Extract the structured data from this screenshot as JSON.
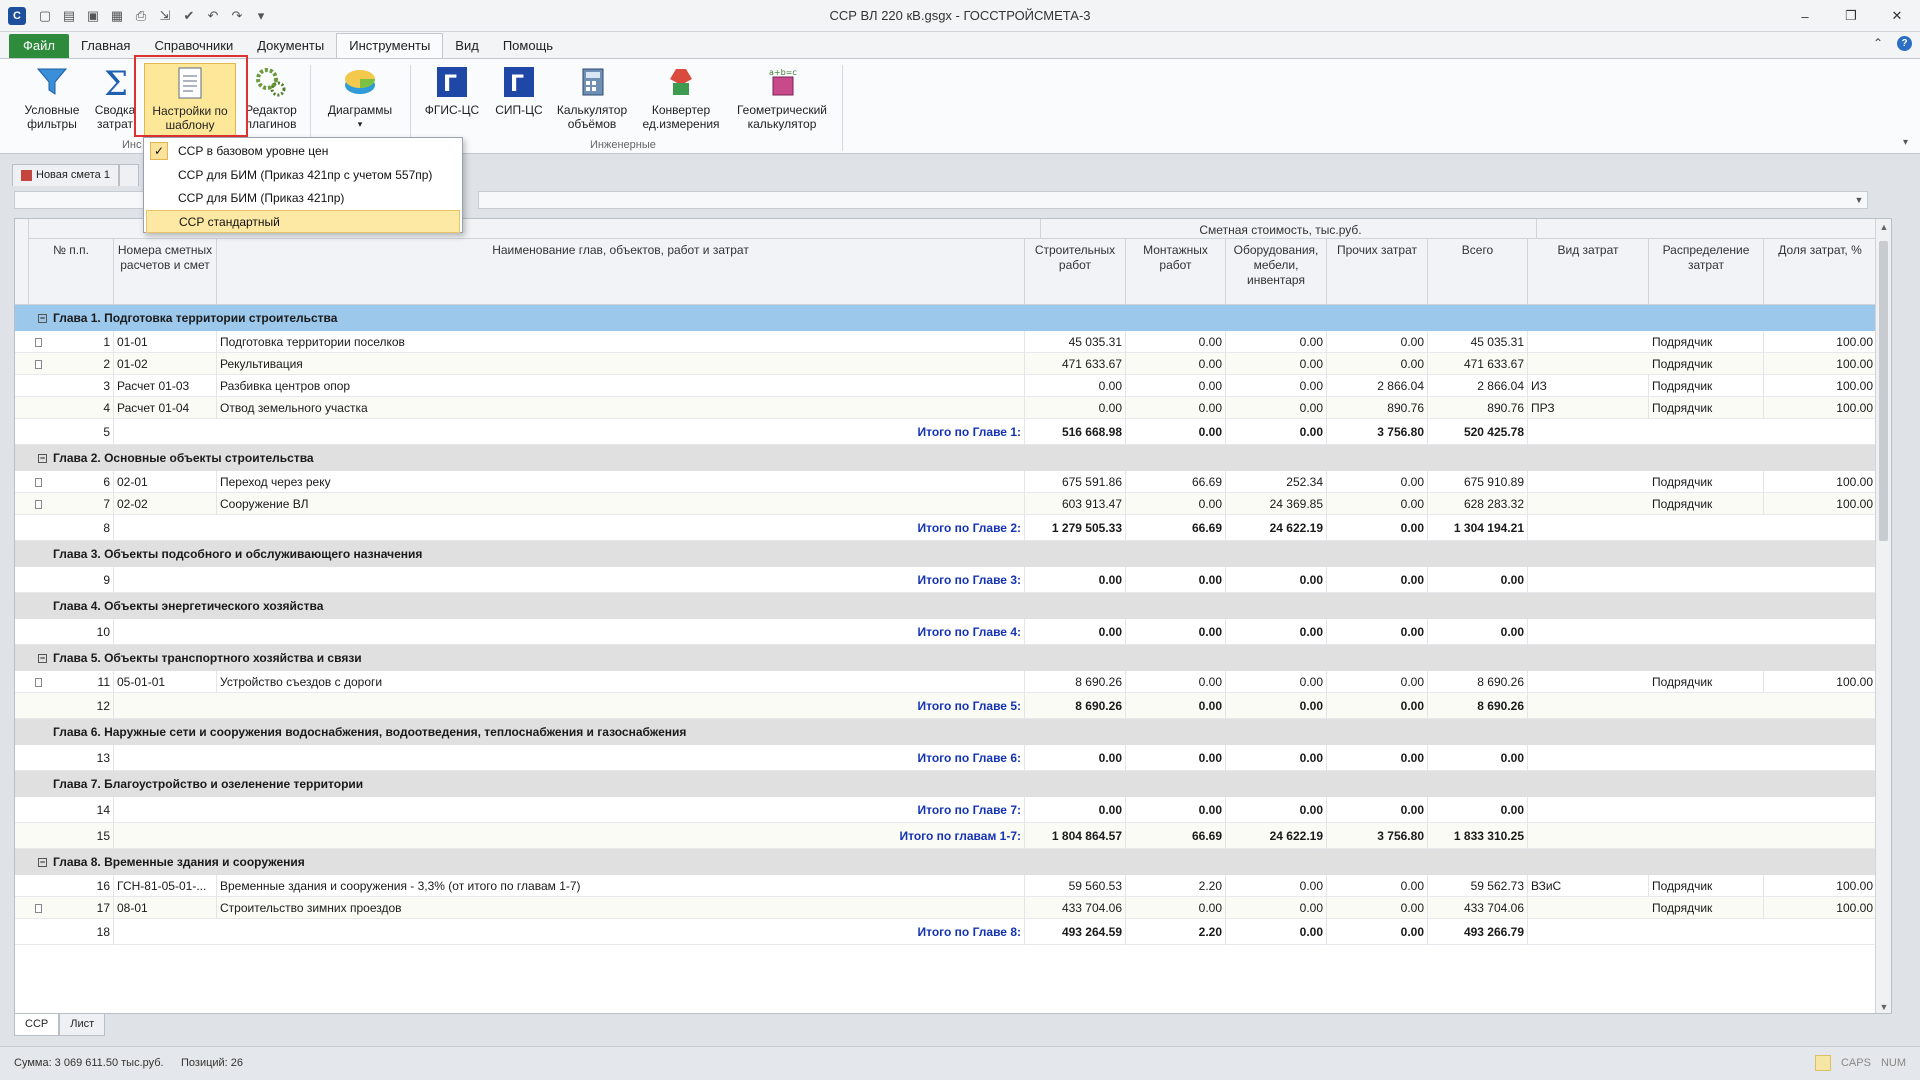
{
  "window": {
    "title": "ССР ВЛ 220 кВ.gsgx - ГОССТРОЙСМЕТА-3",
    "app_icon": "С"
  },
  "ribbon_tabs": [
    "Файл",
    "Главная",
    "Справочники",
    "Документы",
    "Инструменты",
    "Вид",
    "Помощь"
  ],
  "ribbon": {
    "buttons": [
      {
        "label": "Условные фильтры",
        "icon": "funnel-icon"
      },
      {
        "label": "Сводка затрат",
        "icon": "sigma-icon"
      },
      {
        "label": "Настройки по шаблону",
        "icon": "template-doc-icon"
      },
      {
        "label": "Редактор плагинов",
        "icon": "gears-icon"
      },
      {
        "label": "Диаграммы",
        "icon": "pie-chart-icon"
      },
      {
        "label": "ФГИС-ЦС",
        "icon": "fgis-icon"
      },
      {
        "label": "СИП-ЦС",
        "icon": "sip-icon"
      },
      {
        "label": "Калькулятор объёмов",
        "icon": "volume-calc-icon"
      },
      {
        "label": "Конвертер ед.измерения",
        "icon": "unit-converter-icon"
      },
      {
        "label": "Геометрический калькулятор",
        "icon": "geometry-calc-icon"
      }
    ],
    "group_label_left": "Инс",
    "group_label_right": "Инженерные"
  },
  "template_menu": {
    "items": [
      {
        "label": "ССР в базовом уровне цен",
        "checked": true,
        "highlighted": false
      },
      {
        "label": "ССР для БИМ (Приказ 421пр с учетом 557пр)",
        "checked": false,
        "highlighted": false
      },
      {
        "label": "ССР для БИМ (Приказ 421пр)",
        "checked": false,
        "highlighted": false
      },
      {
        "label": "ССР стандартный",
        "checked": false,
        "highlighted": true
      }
    ]
  },
  "doc_tabs": [
    "Новая смета 1"
  ],
  "table": {
    "group_header": "Сметная стоимость, тыс.руб.",
    "columns": [
      "№ п.п.",
      "Номера сметных расчетов и смет",
      "Наименование глав, объектов, работ и затрат",
      "Строительных работ",
      "Монтажных работ",
      "Оборудования, мебели, инвентаря",
      "Прочих затрат",
      "Всего",
      "Вид затрат",
      "Распределение затрат",
      "Доля затрат, %"
    ],
    "rows": [
      {
        "type": "chapter",
        "selected": true,
        "toggle": "⊟",
        "title": "Глава 1. Подготовка территории строительства"
      },
      {
        "type": "data",
        "icon": true,
        "n": "1",
        "code": "01-01",
        "name": "Подготовка территории поселков",
        "c1": "45 035.31",
        "c2": "0.00",
        "c3": "0.00",
        "c4": "0.00",
        "c5": "45 035.31",
        "kind": "",
        "dist": "Подрядчик",
        "share": "100.00"
      },
      {
        "type": "data",
        "icon": true,
        "n": "2",
        "code": "01-02",
        "name": "Рекультивация",
        "c1": "471 633.67",
        "c2": "0.00",
        "c3": "0.00",
        "c4": "0.00",
        "c5": "471 633.67",
        "kind": "",
        "dist": "Подрядчик",
        "share": "100.00"
      },
      {
        "type": "data",
        "icon": false,
        "n": "3",
        "code": "Расчет 01-03",
        "name": "Разбивка центров опор",
        "c1": "0.00",
        "c2": "0.00",
        "c3": "0.00",
        "c4": "2 866.04",
        "c5": "2 866.04",
        "kind": "ИЗ",
        "dist": "Подрядчик",
        "share": "100.00"
      },
      {
        "type": "data",
        "icon": false,
        "n": "4",
        "code": "Расчет 01-04",
        "name": "Отвод земельного участка",
        "c1": "0.00",
        "c2": "0.00",
        "c3": "0.00",
        "c4": "890.76",
        "c5": "890.76",
        "kind": "ПРЗ",
        "dist": "Подрядчик",
        "share": "100.00"
      },
      {
        "type": "total",
        "n": "5",
        "label": "Итого по Главе 1:",
        "c1": "516 668.98",
        "c2": "0.00",
        "c3": "0.00",
        "c4": "3 756.80",
        "c5": "520 425.78"
      },
      {
        "type": "chapter",
        "selected": false,
        "toggle": "⊟",
        "title": "Глава 2. Основные объекты строительства"
      },
      {
        "type": "data",
        "icon": true,
        "n": "6",
        "code": "02-01",
        "name": "Переход через реку",
        "c1": "675 591.86",
        "c2": "66.69",
        "c3": "252.34",
        "c4": "0.00",
        "c5": "675 910.89",
        "kind": "",
        "dist": "Подрядчик",
        "share": "100.00"
      },
      {
        "type": "data",
        "icon": true,
        "n": "7",
        "code": "02-02",
        "name": "Сооружение ВЛ",
        "c1": "603 913.47",
        "c2": "0.00",
        "c3": "24 369.85",
        "c4": "0.00",
        "c5": "628 283.32",
        "kind": "",
        "dist": "Подрядчик",
        "share": "100.00"
      },
      {
        "type": "total",
        "n": "8",
        "label": "Итого по Главе 2:",
        "c1": "1 279 505.33",
        "c2": "66.69",
        "c3": "24 622.19",
        "c4": "0.00",
        "c5": "1 304 194.21"
      },
      {
        "type": "chapter",
        "selected": false,
        "toggle": "",
        "title": "Глава 3. Объекты подсобного и обслуживающего назначения"
      },
      {
        "type": "total",
        "n": "9",
        "label": "Итого по Главе 3:",
        "c1": "0.00",
        "c2": "0.00",
        "c3": "0.00",
        "c4": "0.00",
        "c5": "0.00"
      },
      {
        "type": "chapter",
        "selected": false,
        "toggle": "",
        "title": "Глава 4. Объекты энергетического хозяйства"
      },
      {
        "type": "total",
        "n": "10",
        "label": "Итого по Главе 4:",
        "c1": "0.00",
        "c2": "0.00",
        "c3": "0.00",
        "c4": "0.00",
        "c5": "0.00"
      },
      {
        "type": "chapter",
        "selected": false,
        "toggle": "⊟",
        "title": "Глава 5. Объекты транспортного хозяйства и связи"
      },
      {
        "type": "data",
        "icon": true,
        "n": "11",
        "code": "05-01-01",
        "name": "Устройство съездов с дороги",
        "c1": "8 690.26",
        "c2": "0.00",
        "c3": "0.00",
        "c4": "0.00",
        "c5": "8 690.26",
        "kind": "",
        "dist": "Подрядчик",
        "share": "100.00"
      },
      {
        "type": "total",
        "n": "12",
        "label": "Итого по Главе 5:",
        "c1": "8 690.26",
        "c2": "0.00",
        "c3": "0.00",
        "c4": "0.00",
        "c5": "8 690.26"
      },
      {
        "type": "chapter",
        "selected": false,
        "toggle": "",
        "title": "Глава 6. Наружные сети и сооружения водоснабжения, водоотведения, теплоснабжения и газоснабжения"
      },
      {
        "type": "total",
        "n": "13",
        "label": "Итого по Главе 6:",
        "c1": "0.00",
        "c2": "0.00",
        "c3": "0.00",
        "c4": "0.00",
        "c5": "0.00"
      },
      {
        "type": "chapter",
        "selected": false,
        "toggle": "",
        "title": "Глава 7. Благоустройство и озеленение территории"
      },
      {
        "type": "total",
        "n": "14",
        "label": "Итого по Главе 7:",
        "c1": "0.00",
        "c2": "0.00",
        "c3": "0.00",
        "c4": "0.00",
        "c5": "0.00"
      },
      {
        "type": "total",
        "n": "15",
        "label": "Итого по главам 1-7:",
        "c1": "1 804 864.57",
        "c2": "66.69",
        "c3": "24 622.19",
        "c4": "3 756.80",
        "c5": "1 833 310.25"
      },
      {
        "type": "chapter",
        "selected": false,
        "toggle": "⊟",
        "title": "Глава 8. Временные здания и сооружения"
      },
      {
        "type": "data",
        "icon": false,
        "n": "16",
        "code": "ГСН-81-05-01-...",
        "name": "Временные здания и сооружения - 3,3% (от итого по главам 1-7)",
        "c1": "59 560.53",
        "c2": "2.20",
        "c3": "0.00",
        "c4": "0.00",
        "c5": "59 562.73",
        "kind": "ВЗиС",
        "dist": "Подрядчик",
        "share": "100.00"
      },
      {
        "type": "data",
        "icon": true,
        "n": "17",
        "code": "08-01",
        "name": "Строительство зимних проездов",
        "c1": "433 704.06",
        "c2": "0.00",
        "c3": "0.00",
        "c4": "0.00",
        "c5": "433 704.06",
        "kind": "",
        "dist": "Подрядчик",
        "share": "100.00"
      },
      {
        "type": "total",
        "n": "18",
        "label": "Итого по Главе 8:",
        "c1": "493 264.59",
        "c2": "2.20",
        "c3": "0.00",
        "c4": "0.00",
        "c5": "493 266.79"
      }
    ]
  },
  "sheet_tabs": [
    "ССР",
    "Лист"
  ],
  "status": {
    "sum": "Сумма: 3 069 611.50 тыс.руб.",
    "positions": "Позиций:  26",
    "caps": "CAPS",
    "num": "NUM"
  }
}
